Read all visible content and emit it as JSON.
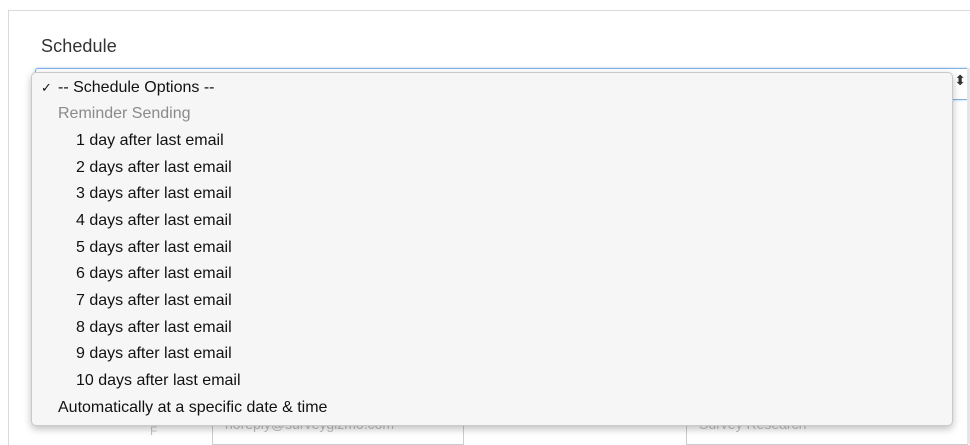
{
  "schedule": {
    "label": "Schedule",
    "select_arrow": "⬍"
  },
  "dropdown": {
    "check_mark": "✓",
    "selected": "-- Schedule Options --",
    "group_label": "Reminder Sending",
    "options": [
      "1 day after last email",
      "2 days after last email",
      "3 days after last email",
      "4 days after last email",
      "5 days after last email",
      "6 days after last email",
      "7 days after last email",
      "8 days after last email",
      "9 days after last email",
      "10 days after last email"
    ],
    "last_option": "Automatically at a specific date & time"
  },
  "background": {
    "field_left_ghost": "noreply@surveygizmo.com",
    "field_right_ghost": "Survey Research",
    "left_label_ghost": "F"
  }
}
